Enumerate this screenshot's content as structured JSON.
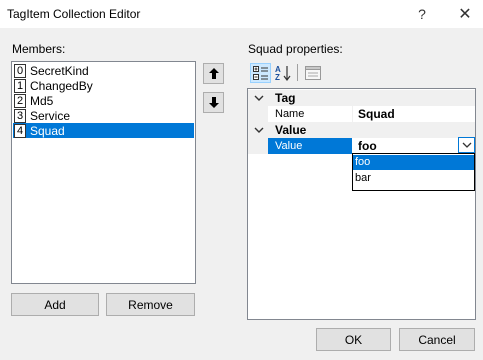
{
  "window": {
    "title": "TagItem Collection Editor",
    "help_glyph": "?",
    "close_glyph": "✕"
  },
  "members": {
    "label": "Members:",
    "items": [
      {
        "index": "0",
        "name": "SecretKind"
      },
      {
        "index": "1",
        "name": "ChangedBy"
      },
      {
        "index": "2",
        "name": "Md5"
      },
      {
        "index": "3",
        "name": "Service"
      },
      {
        "index": "4",
        "name": "Squad"
      }
    ],
    "selected_index": 4,
    "add_label": "Add",
    "remove_label": "Remove"
  },
  "properties": {
    "label": "Squad properties:",
    "categories": [
      {
        "name": "Tag",
        "rows": [
          {
            "name": "Name",
            "value": "Squad"
          }
        ]
      },
      {
        "name": "Value",
        "rows": [
          {
            "name": "Value",
            "value": "foo"
          }
        ]
      }
    ],
    "dropdown_options": [
      "foo",
      "bar"
    ],
    "dropdown_selected": "foo"
  },
  "footer": {
    "ok_label": "OK",
    "cancel_label": "Cancel"
  },
  "colors": {
    "accent": "#0078d7",
    "dialog_bg": "#f0f0f0"
  }
}
